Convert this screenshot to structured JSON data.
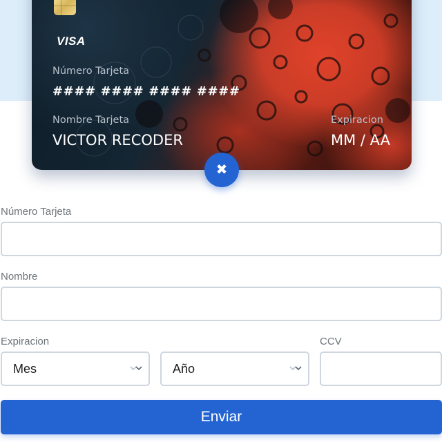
{
  "card": {
    "brand": "VISA",
    "number_label": "Número Tarjeta",
    "number_value": "#### #### #### ####",
    "name_label": "Nombre Tarjeta",
    "name_value": "VICTOR RECODER",
    "expiry_label": "Expiracion",
    "expiry_value": "MM / AA"
  },
  "form": {
    "number_label": "Número Tarjeta",
    "number_value": "",
    "name_label": "Nombre",
    "name_value": "",
    "expiry_label": "Expiracion",
    "month_selected": "Mes",
    "year_selected": "Año",
    "ccv_label": "CCV",
    "ccv_value": "",
    "submit_label": "Enviar"
  },
  "colors": {
    "accent": "#2364d2",
    "top_background": "#ddeefa",
    "input_border": "#ced6e0"
  },
  "icons": {
    "close": "close-icon",
    "chevron": "chevron-down-icon",
    "chip": "card-chip-icon"
  }
}
